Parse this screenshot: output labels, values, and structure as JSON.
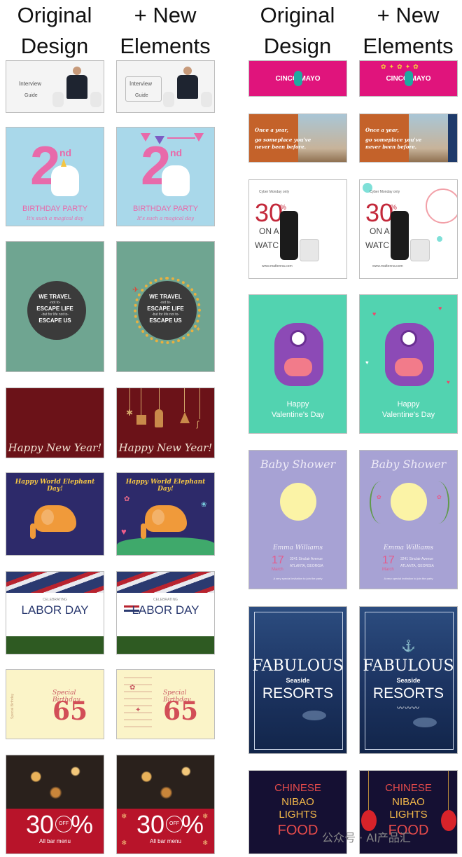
{
  "headers": {
    "left_original": "Original\nDesign",
    "left_new": "+ New\nElements",
    "right_original": "Original\nDesign",
    "right_new": "+ New\nElements"
  },
  "left_column": {
    "interview": {
      "line1": "Interview",
      "line2": "Guide"
    },
    "birthday": {
      "number": "2",
      "suffix": "nd",
      "title": "BIRTHDAY PARTY",
      "subtitle": "It's such a magical day"
    },
    "travel": {
      "l1": "WE TRAVEL",
      "l2": "-not to-",
      "l3": "ESCAPE LIFE",
      "l4": "-but for life not to-",
      "l5": "ESCAPE US"
    },
    "newyear": {
      "text": "Happy New Year!"
    },
    "elephant": {
      "text": "Happy World Elephant Day!"
    },
    "labor": {
      "small": "CELEBRATING",
      "title": "LABOR DAY"
    },
    "bday65": {
      "side": "Special Birthday",
      "script": "Special Birthday",
      "number": "65"
    },
    "offer": {
      "big": "30",
      "off": "OFF",
      "pct": "%",
      "sub": "All bar menu"
    }
  },
  "right_column": {
    "cinco": {
      "text": "CINCO MAYO"
    },
    "travel2": {
      "l1": "Once a year,",
      "l2": "go someplace you've",
      "l3": "never been before."
    },
    "cyber": {
      "small": "Cyber Monday only",
      "big": "30",
      "pct": "%",
      "on": "ON A",
      "watch": "WATC",
      "url": "www.mattenna.com"
    },
    "valentine": {
      "l1": "Happy",
      "l2": "Valentine's Day"
    },
    "baby": {
      "title": "Baby Shower",
      "name": "Emma Williams",
      "date": "17",
      "month": "March",
      "addr1": "3241 Sinclair Avenue",
      "addr2": "ATLANTA, GEORGIA",
      "note": "A very special invitation to join the party"
    },
    "resort": {
      "l1": "FABULOUS",
      "l2": "Seaside",
      "l3": "RESORTS"
    },
    "chinese": {
      "l1": "CHINESE",
      "l2": "NIBAO",
      "l3": "LIGHTS",
      "l4": "FOOD"
    }
  },
  "watermark": "公众号 · AI产品汇",
  "colors": {
    "birthday_bg": "#a9d8ea",
    "travel_bg": "#6fa591",
    "newyear_bg": "#6b1218",
    "elephant_bg": "#2d2a6a",
    "bday65_bg": "#fbf4c8",
    "cinco_bg": "#e0147c",
    "valentine_bg": "#52d3b0",
    "baby_bg": "#a7a2d4",
    "resort_bg": "#1f3a6b",
    "chinese_bg": "#151033"
  }
}
